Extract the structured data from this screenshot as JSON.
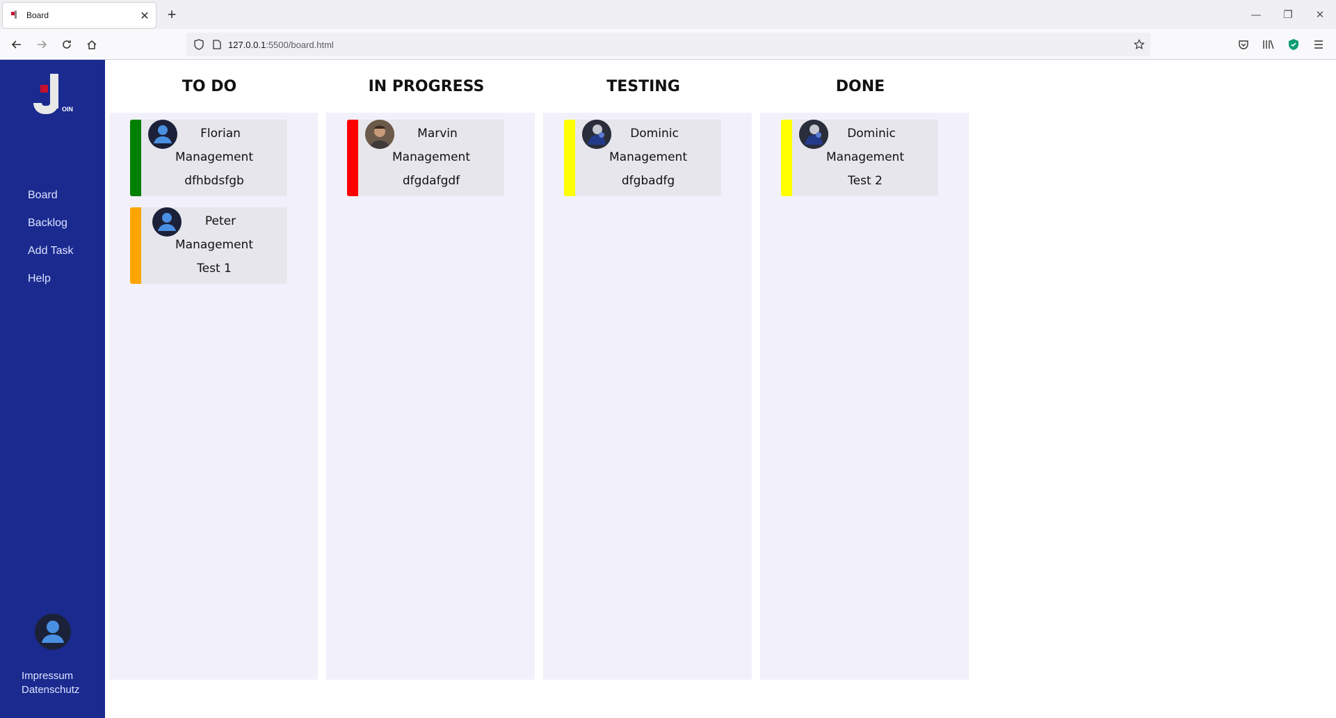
{
  "browser": {
    "tab_title": "Board",
    "url_host": "127.0.0.1",
    "url_rest": ":5500/board.html"
  },
  "sidebar": {
    "logo_text": "OIN",
    "items": [
      {
        "label": "Board"
      },
      {
        "label": "Backlog"
      },
      {
        "label": "Add Task"
      },
      {
        "label": "Help"
      }
    ],
    "footer": {
      "impressum": "Impressum",
      "datenschutz": "Datenschutz"
    }
  },
  "board": {
    "columns": [
      {
        "title": "TO DO",
        "cards": [
          {
            "name": "Florian",
            "category": "Management",
            "title": "dfhbdsfgb",
            "urgency_color": "#008000",
            "avatar": "default-user-icon"
          },
          {
            "name": "Peter",
            "category": "Management",
            "title": "Test 1",
            "urgency_color": "#ffa500",
            "avatar": "default-user-icon"
          }
        ]
      },
      {
        "title": "IN PROGRESS",
        "cards": [
          {
            "name": "Marvin",
            "category": "Management",
            "title": "dfgdafgdf",
            "urgency_color": "#ff0000",
            "avatar": "photo-avatar"
          }
        ]
      },
      {
        "title": "TESTING",
        "cards": [
          {
            "name": "Dominic",
            "category": "Management",
            "title": "dfgbadfg",
            "urgency_color": "#ffff00",
            "avatar": "photo-avatar"
          }
        ]
      },
      {
        "title": "DONE",
        "cards": [
          {
            "name": "Dominic",
            "category": "Management",
            "title": "Test 2",
            "urgency_color": "#ffff00",
            "avatar": "photo-avatar"
          }
        ]
      }
    ]
  }
}
